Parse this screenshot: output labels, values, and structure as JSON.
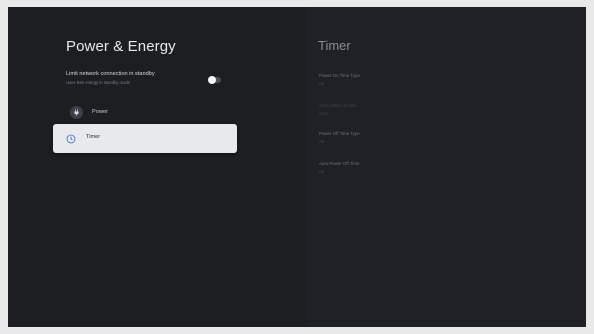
{
  "left": {
    "title": "Power & Energy",
    "standby": {
      "title": "Limit network connection in standby",
      "subtitle": "Uses less energy in standby mode",
      "toggle_on": false
    },
    "items": [
      {
        "label": "Power",
        "icon": "power-plug-icon",
        "selected": false
      },
      {
        "label": "Timer",
        "icon": "clock-icon",
        "selected": true
      }
    ]
  },
  "right": {
    "title": "Timer",
    "items": [
      {
        "label": "Power On Time Type",
        "value": "Off",
        "dim": false
      },
      {
        "label": "Auto power on time",
        "value": "00:00",
        "dim": true
      },
      {
        "label": "Power Off Time Type",
        "value": "Off",
        "dim": false
      },
      {
        "label": "Auto Power Off Time",
        "value": "Off",
        "dim": false
      }
    ]
  },
  "colors": {
    "background": "#1f2126",
    "selected_row": "#e8e9ec",
    "title_text": "#e6e7ea"
  }
}
